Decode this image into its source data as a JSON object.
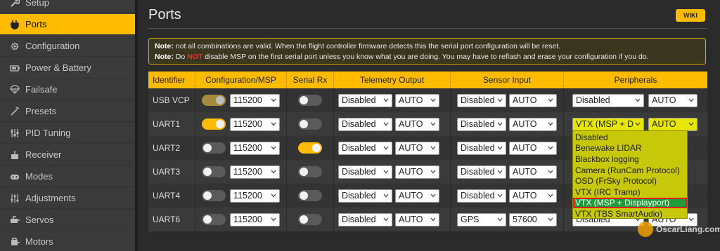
{
  "sidebar": {
    "items": [
      {
        "label": "Setup",
        "icon": "wrench-icon"
      },
      {
        "label": "Ports",
        "icon": "plug-icon",
        "active": true
      },
      {
        "label": "Configuration",
        "icon": "gear-icon"
      },
      {
        "label": "Power & Battery",
        "icon": "battery-icon"
      },
      {
        "label": "Failsafe",
        "icon": "parachute-icon"
      },
      {
        "label": "Presets",
        "icon": "magic-wand-icon"
      },
      {
        "label": "PID Tuning",
        "icon": "sliders-icon"
      },
      {
        "label": "Receiver",
        "icon": "receiver-icon"
      },
      {
        "label": "Modes",
        "icon": "gamepad-icon"
      },
      {
        "label": "Adjustments",
        "icon": "adjust-icon"
      },
      {
        "label": "Servos",
        "icon": "servo-icon"
      },
      {
        "label": "Motors",
        "icon": "motor-icon"
      }
    ]
  },
  "header": {
    "title": "Ports",
    "wiki_label": "WIKI"
  },
  "note": {
    "line1_prefix": "Note:",
    "line1_text": " not all combinations are valid. When the flight controller firmware detects this the serial port configuration will be reset.",
    "line2_prefix": "Note:",
    "line2_do": " Do ",
    "line2_not": "NOT",
    "line2_text": " disable MSP on the first serial port unless you know what you are doing. You may have to reflash and erase your configuration if you do."
  },
  "table": {
    "headers": [
      "Identifier",
      "Configuration/MSP",
      "Serial Rx",
      "Telemetry Output",
      "Sensor Input",
      "Peripherals"
    ],
    "rows": [
      {
        "id": "USB VCP",
        "msp": "dim",
        "baud": "115200",
        "rx": false,
        "telemetry": "Disabled",
        "tel_baud": "AUTO",
        "sensor": "Disabled",
        "sensor_baud": "AUTO",
        "periph": "Disabled",
        "periph_baud": "AUTO"
      },
      {
        "id": "UART1",
        "msp": "on",
        "baud": "115200",
        "rx": false,
        "telemetry": "Disabled",
        "tel_baud": "AUTO",
        "sensor": "Disabled",
        "sensor_baud": "AUTO",
        "periph": "VTX (MSP + D",
        "periph_baud": "AUTO"
      },
      {
        "id": "UART2",
        "msp": "off",
        "baud": "115200",
        "rx": true,
        "telemetry": "Disabled",
        "tel_baud": "AUTO",
        "sensor": "Disabled",
        "sensor_baud": "AUTO"
      },
      {
        "id": "UART3",
        "msp": "off",
        "baud": "115200",
        "rx": false,
        "telemetry": "Disabled",
        "tel_baud": "AUTO",
        "sensor": "Disabled",
        "sensor_baud": "AUTO"
      },
      {
        "id": "UART4",
        "msp": "off",
        "baud": "115200",
        "rx": false,
        "telemetry": "Disabled",
        "tel_baud": "AUTO",
        "sensor": "Disabled",
        "sensor_baud": "AUTO"
      },
      {
        "id": "UART6",
        "msp": "off",
        "baud": "115200",
        "rx": false,
        "telemetry": "Disabled",
        "tel_baud": "AUTO",
        "sensor": "GPS",
        "sensor_baud": "57600",
        "periph": "Disabled",
        "periph_baud": "AUTO"
      }
    ]
  },
  "dropdown": {
    "options": [
      "Disabled",
      "Benewake LIDAR",
      "Blackbox logging",
      "Camera (RunCam Protocol)",
      "OSD (FrSky Protocol)",
      "VTX (IRC Tramp)",
      "VTX (MSP + Displayport)",
      "VTX (TBS SmartAudio)"
    ],
    "highlighted_index": 6
  },
  "watermark": {
    "text": "OscarLiang.com"
  },
  "colors": {
    "accent": "#ffbb00",
    "sidebar_bg": "#3a3a3a",
    "main_bg": "#2b2b2b",
    "dropdown_bg": "#c8c80a",
    "highlight": "#1f9d3a"
  }
}
